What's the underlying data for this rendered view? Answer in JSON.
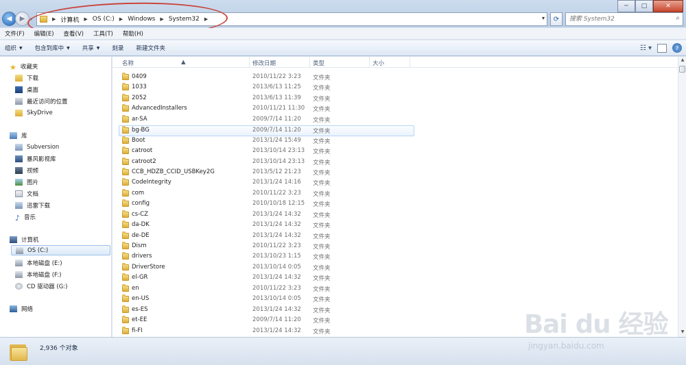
{
  "window": {
    "minimize": "─",
    "maximize": "□",
    "close": "✕"
  },
  "address": {
    "crumbs": [
      "计算机",
      "OS (C:)",
      "Windows",
      "System32"
    ],
    "dropdown_glyph": "▾",
    "refresh_glyph": "⟳"
  },
  "search": {
    "placeholder": "搜索 System32"
  },
  "menu": [
    "文件(F)",
    "编辑(E)",
    "查看(V)",
    "工具(T)",
    "帮助(H)"
  ],
  "toolbar": {
    "organize": "组织",
    "include_library": "包含到库中",
    "share": "共享",
    "burn": "刻录",
    "new_folder": "新建文件夹",
    "help": "?"
  },
  "sidebar": {
    "favorites": {
      "label": "收藏夹",
      "items": [
        "下载",
        "桌面",
        "最近访问的位置",
        "SkyDrive"
      ]
    },
    "libraries": {
      "label": "库",
      "items": [
        "Subversion",
        "暴风影视库",
        "视频",
        "图片",
        "文档",
        "迅雷下载",
        "音乐"
      ]
    },
    "computer": {
      "label": "计算机",
      "items": [
        "OS (C:)",
        "本地磁盘 (E:)",
        "本地磁盘 (F:)",
        "CD 驱动器 (G:)"
      ]
    },
    "network": {
      "label": "网络"
    }
  },
  "columns": {
    "name": "名称",
    "date": "修改日期",
    "type": "类型",
    "size": "大小"
  },
  "files": [
    {
      "name": "0409",
      "date": "2010/11/22 3:23",
      "type": "文件夹"
    },
    {
      "name": "1033",
      "date": "2013/6/13 11:25",
      "type": "文件夹"
    },
    {
      "name": "2052",
      "date": "2013/6/13 11:39",
      "type": "文件夹"
    },
    {
      "name": "AdvancedInstallers",
      "date": "2010/11/21 11:30",
      "type": "文件夹"
    },
    {
      "name": "ar-SA",
      "date": "2009/7/14 11:20",
      "type": "文件夹"
    },
    {
      "name": "bg-BG",
      "date": "2009/7/14 11:20",
      "type": "文件夹"
    },
    {
      "name": "Boot",
      "date": "2013/1/24 15:49",
      "type": "文件夹"
    },
    {
      "name": "catroot",
      "date": "2013/10/14 23:13",
      "type": "文件夹"
    },
    {
      "name": "catroot2",
      "date": "2013/10/14 23:13",
      "type": "文件夹"
    },
    {
      "name": "CCB_HDZB_CCID_USBKey2G",
      "date": "2013/5/12 21:23",
      "type": "文件夹"
    },
    {
      "name": "CodeIntegrity",
      "date": "2013/1/24 14:16",
      "type": "文件夹"
    },
    {
      "name": "com",
      "date": "2010/11/22 3:23",
      "type": "文件夹"
    },
    {
      "name": "config",
      "date": "2010/10/18 12:15",
      "type": "文件夹"
    },
    {
      "name": "cs-CZ",
      "date": "2013/1/24 14:32",
      "type": "文件夹"
    },
    {
      "name": "da-DK",
      "date": "2013/1/24 14:32",
      "type": "文件夹"
    },
    {
      "name": "de-DE",
      "date": "2013/1/24 14:32",
      "type": "文件夹"
    },
    {
      "name": "Dism",
      "date": "2010/11/22 3:23",
      "type": "文件夹"
    },
    {
      "name": "drivers",
      "date": "2013/10/23 1:15",
      "type": "文件夹"
    },
    {
      "name": "DriverStore",
      "date": "2013/10/14 0:05",
      "type": "文件夹"
    },
    {
      "name": "el-GR",
      "date": "2013/1/24 14:32",
      "type": "文件夹"
    },
    {
      "name": "en",
      "date": "2010/11/22 3:23",
      "type": "文件夹"
    },
    {
      "name": "en-US",
      "date": "2013/10/14 0:05",
      "type": "文件夹"
    },
    {
      "name": "es-ES",
      "date": "2013/1/24 14:32",
      "type": "文件夹"
    },
    {
      "name": "et-EE",
      "date": "2009/7/14 11:20",
      "type": "文件夹"
    },
    {
      "name": "fi-FI",
      "date": "2013/1/24 14:32",
      "type": "文件夹"
    }
  ],
  "status": {
    "count": "2,936 个对象"
  },
  "watermark": {
    "title": "Bai du 经验",
    "url": "jingyan.baidu.com"
  },
  "colors": {
    "accent": "#1f63b9",
    "annotation": "#c9453b",
    "folder": "#e1b84c"
  }
}
